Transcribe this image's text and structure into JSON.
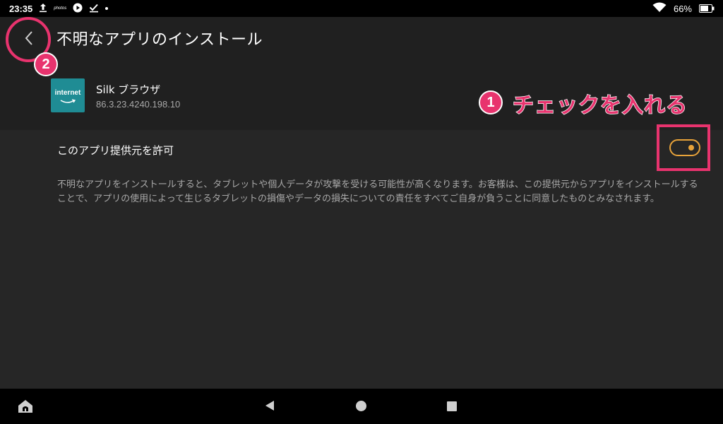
{
  "status_bar": {
    "time": "23:35",
    "photos_label": "photos",
    "battery_percent": "66%",
    "icons": [
      "upload-icon",
      "photos-icon",
      "play-icon",
      "checkmark-icon",
      "dot-icon",
      "wifi-icon",
      "battery-icon"
    ]
  },
  "header": {
    "title": "不明なアプリのインストール",
    "back_icon": "chevron-left-icon"
  },
  "app": {
    "icon_label": "internet",
    "name": "Silk ブラウザ",
    "version": "86.3.23.4240.198.10"
  },
  "permission": {
    "label": "このアプリ提供元を許可",
    "enabled": true,
    "description": "不明なアプリをインストールすると、タブレットや個人データが攻撃を受ける可能性が高くなります。お客様は、この提供元からアプリをインストールすることで、アプリの使用によって生じるタブレットの損傷やデータの損失についての責任をすべてご自身が負うことに同意したものとみなされます。"
  },
  "annotations": {
    "badge_1": "1",
    "badge_1_text": "チェックを入れる",
    "badge_2": "2",
    "color": "#e8336e"
  },
  "nav_bar": {
    "icons": [
      "home-launcher-icon",
      "back-triangle-icon",
      "home-circle-icon",
      "recents-square-icon"
    ]
  },
  "colors": {
    "background": "#202020",
    "section_background": "#262626",
    "toggle_accent": "#e8a33a",
    "secondary_text": "#a8a8a8"
  }
}
